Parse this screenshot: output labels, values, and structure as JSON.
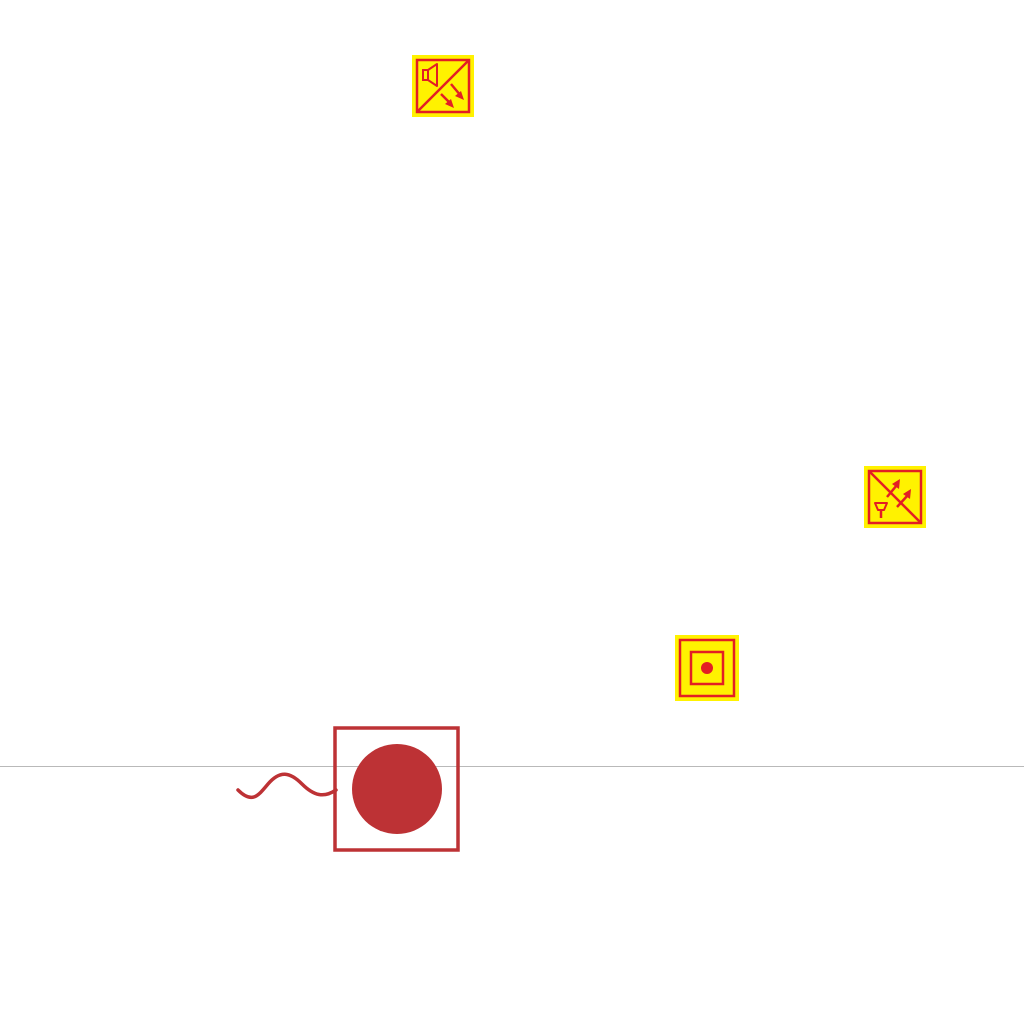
{
  "colors": {
    "background": "#ffffff",
    "symbol_fill": "#fff200",
    "symbol_stroke": "#e31e24",
    "manual_call_point": "#bd3235",
    "baseline": "#b9b9b9"
  },
  "symbols": [
    {
      "icon": "speaker-sounder-icon"
    },
    {
      "icon": "horn-sounder-icon"
    },
    {
      "icon": "call-button-icon"
    },
    {
      "icon": "manual-call-point-icon"
    }
  ]
}
